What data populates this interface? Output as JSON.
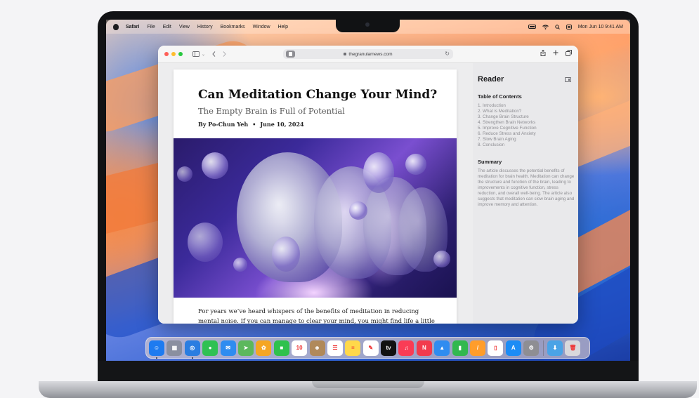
{
  "menubar": {
    "app_name": "Safari",
    "items": [
      "File",
      "Edit",
      "View",
      "History",
      "Bookmarks",
      "Window",
      "Help"
    ],
    "clock": "Mon Jun 10  9:41 AM"
  },
  "browser": {
    "url": "thegranularnews.com",
    "traffic_lights": [
      "#ff5f57",
      "#febc2e",
      "#28c840"
    ]
  },
  "article": {
    "title": "Can Meditation Change Your Mind?",
    "subtitle": "The Empty Brain is Full of Potential",
    "author": "By Po-Chun Yeh",
    "separator": "•",
    "date": "June 10, 2024",
    "body": "For years we’ve heard whispers of the benefits of meditation in reducing mental noise. If you can manage to clear your mind, you might find life a little bit lighter."
  },
  "reader": {
    "title": "Reader",
    "toc_heading": "Table of Contents",
    "toc": [
      "1. Introduction",
      "2. What is Meditation?",
      "3. Change Brain Structure",
      "4. Strengthen Brain Networks",
      "5. Improve Cognitive Function",
      "6. Reduce Stress and Anxiety",
      "7. Slow Brain Aging",
      "8. Conclusion"
    ],
    "summary_heading": "Summary",
    "summary": "The article discusses the potential benefits of meditation for brain health. Meditation can change the structure and function of the brain, leading to improvements in cognitive function, stress reduction, and overall well-being. The article also suggests that meditation can slow brain aging and improve memory and attention."
  },
  "dock": {
    "apps": [
      {
        "name": "finder",
        "color": "#1e7bf0",
        "glyph": "☺",
        "running": true
      },
      {
        "name": "launchpad",
        "color": "#8a8fa0",
        "glyph": "▦",
        "running": false
      },
      {
        "name": "safari",
        "color": "#2a7de1",
        "glyph": "◎",
        "running": true
      },
      {
        "name": "messages",
        "color": "#30c153",
        "glyph": "●",
        "running": false
      },
      {
        "name": "mail",
        "color": "#2f8cf0",
        "glyph": "✉",
        "running": false
      },
      {
        "name": "maps",
        "color": "#5cb85c",
        "glyph": "➤",
        "running": false
      },
      {
        "name": "photos",
        "color": "#f5a623",
        "glyph": "✿",
        "running": false
      },
      {
        "name": "facetime",
        "color": "#2fc14d",
        "glyph": "■",
        "running": false
      },
      {
        "name": "calendar",
        "color": "#ffffff",
        "glyph": "10",
        "running": false
      },
      {
        "name": "contacts",
        "color": "#b0895a",
        "glyph": "☻",
        "running": false
      },
      {
        "name": "reminders",
        "color": "#ffffff",
        "glyph": "☰",
        "running": false
      },
      {
        "name": "notes",
        "color": "#ffd84a",
        "glyph": "≡",
        "running": false
      },
      {
        "name": "freeform",
        "color": "#ffffff",
        "glyph": "✎",
        "running": false
      },
      {
        "name": "tv",
        "color": "#111111",
        "glyph": "tv",
        "running": false
      },
      {
        "name": "music",
        "color": "#fa3c55",
        "glyph": "♫",
        "running": false
      },
      {
        "name": "news",
        "color": "#f23b4d",
        "glyph": "N",
        "running": false
      },
      {
        "name": "keynote",
        "color": "#2f8cf0",
        "glyph": "▲",
        "running": false
      },
      {
        "name": "numbers",
        "color": "#32b84f",
        "glyph": "▮",
        "running": false
      },
      {
        "name": "pages",
        "color": "#ff9d2b",
        "glyph": "/",
        "running": false
      },
      {
        "name": "iphone-mirroring",
        "color": "#ffffff",
        "glyph": "▯",
        "running": false
      },
      {
        "name": "app-store",
        "color": "#1c8cf5",
        "glyph": "A",
        "running": false
      },
      {
        "name": "system-settings",
        "color": "#8e8e93",
        "glyph": "⚙",
        "running": false
      },
      {
        "name": "downloads",
        "color": "#4aa3e6",
        "glyph": "⬇",
        "running": false
      },
      {
        "name": "trash",
        "color": "#d8d8dc",
        "glyph": "🗑",
        "running": false
      }
    ]
  }
}
